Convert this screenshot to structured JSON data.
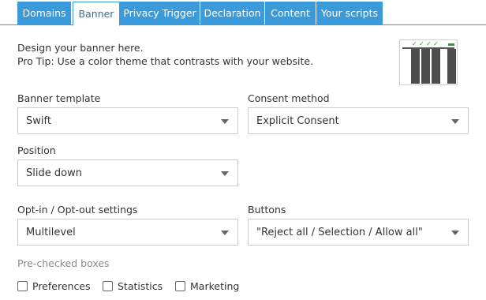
{
  "tabs": [
    {
      "label": "Domains",
      "active": false
    },
    {
      "label": "Banner",
      "active": true
    },
    {
      "label": "Privacy Trigger",
      "active": false
    },
    {
      "label": "Declaration",
      "active": false
    },
    {
      "label": "Content",
      "active": false
    },
    {
      "label": "Your scripts",
      "active": false
    }
  ],
  "intro": {
    "line1": "Design your banner here.",
    "line2": "Pro Tip: Use a color theme that contrasts with your website."
  },
  "preview": {
    "checks": [
      "✓",
      "✓",
      "✓",
      "✓"
    ],
    "icon": "banner-layout-preview"
  },
  "fields": {
    "banner_template": {
      "label": "Banner template",
      "value": "Swift"
    },
    "consent_method": {
      "label": "Consent method",
      "value": "Explicit Consent"
    },
    "position": {
      "label": "Position",
      "value": "Slide down"
    },
    "opt_settings": {
      "label": "Opt-in / Opt-out settings",
      "value": "Multilevel"
    },
    "buttons": {
      "label": "Buttons",
      "value": "\"Reject all / Selection / Allow all\""
    }
  },
  "prechecked": {
    "label": "Pre-checked boxes",
    "options": [
      {
        "label": "Preferences",
        "checked": false
      },
      {
        "label": "Statistics",
        "checked": false
      },
      {
        "label": "Marketing",
        "checked": false
      }
    ]
  },
  "colors": {
    "tab_blue": "#3b9ad9",
    "check_green": "#2e9a2e"
  }
}
